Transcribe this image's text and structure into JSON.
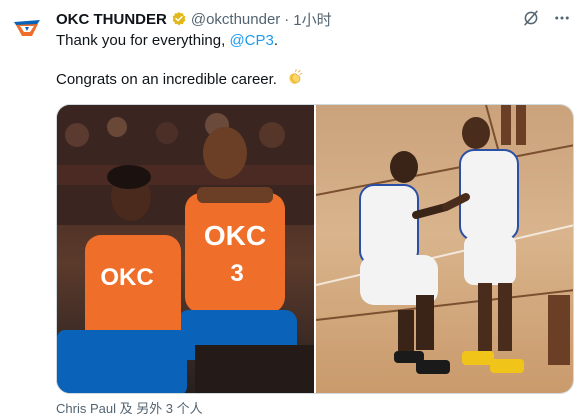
{
  "tweet": {
    "author_name": "OKC THUNDER",
    "handle": "@okcthunder",
    "separator": "·",
    "time": "1小时",
    "line1_prefix": "Thank you for everything, ",
    "mention": "@CP3",
    "line1_suffix": ".",
    "line2": "Congrats on an incredible career.",
    "clap_icon": "clapping-hands-emoji",
    "media_caption": "Chris Paul 及 另外 3 个人"
  },
  "icons": {
    "avatar": "okc-thunder-logo",
    "verified": "gold-verified-badge-icon",
    "grok": "grok-icon",
    "more": "more-icon"
  },
  "colors": {
    "accent": "#1d9bf0",
    "verified_gold": "#e2b719",
    "secondary_text": "#536471",
    "okc_orange": "#ef6e2a",
    "okc_blue": "#0a63b8"
  },
  "photo_left_jersey_text": "OKC",
  "photo_left_number": "3"
}
